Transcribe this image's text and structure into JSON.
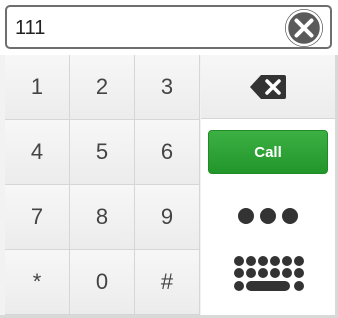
{
  "number_field": {
    "value": "111",
    "clear_icon": "close-circle-icon"
  },
  "keypad": {
    "keys": [
      {
        "label": "1"
      },
      {
        "label": "2"
      },
      {
        "label": "3"
      },
      {
        "label": "4"
      },
      {
        "label": "5"
      },
      {
        "label": "6"
      },
      {
        "label": "7"
      },
      {
        "label": "8"
      },
      {
        "label": "9"
      },
      {
        "label": "*"
      },
      {
        "label": "0"
      },
      {
        "label": "#"
      }
    ]
  },
  "actions": {
    "backspace_icon": "backspace-icon",
    "call_label": "Call",
    "more_icon": "more-dots-icon",
    "keyboard_icon": "keyboard-icon"
  },
  "colors": {
    "call_green": "#2aa532",
    "icon_dark": "#333333",
    "clear_gray": "#5a5a5a"
  }
}
